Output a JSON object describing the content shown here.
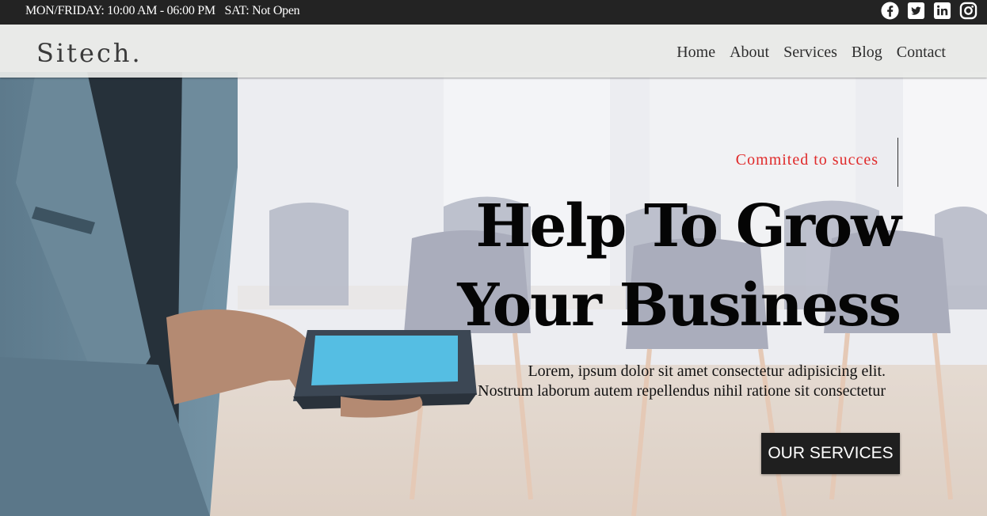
{
  "topbar": {
    "hours_weekday": "MON/FRIDAY: 10:00 AM - 06:00 PM",
    "hours_saturday": "SAT: Not Open",
    "social_icons": [
      "facebook-icon",
      "twitter-icon",
      "linkedin-icon",
      "instagram-icon"
    ]
  },
  "navbar": {
    "logo": "Sitech.",
    "links": [
      "Home",
      "About",
      "Services",
      "Blog",
      "Contact"
    ]
  },
  "hero": {
    "tagline": "Commited to succes",
    "headline_line1": "Help To Grow",
    "headline_line2": "Your Business",
    "description_line1": "Lorem, ipsum dolor sit amet consectetur adipisicing elit.",
    "description_line2": "Nostrum laborum autem repellendus nihil ratione sit consectetur",
    "cta_label": "OUR SERVICES"
  },
  "colors": {
    "topbar_bg": "#232323",
    "tagline": "#e02a2a",
    "cta_bg": "#1f1f1f"
  }
}
